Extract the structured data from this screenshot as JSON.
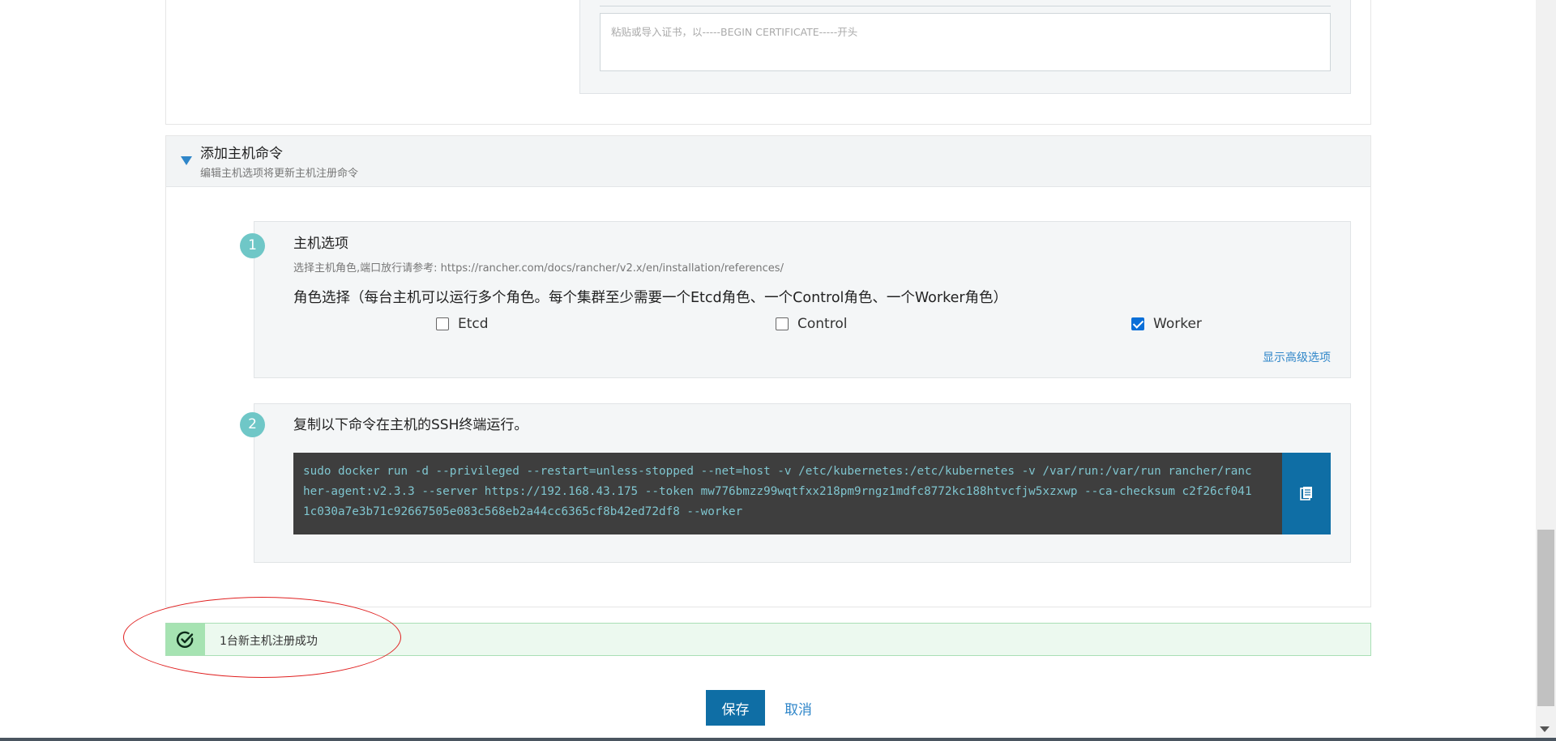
{
  "certificate": {
    "placeholder": "粘贴或导入证书，以-----BEGIN CERTIFICATE-----开头"
  },
  "accordion": {
    "title": "添加主机命令",
    "subtitle": "编辑主机选项将更新主机注册命令"
  },
  "step1": {
    "number": "1",
    "title": "主机选项",
    "desc": "选择主机角色,端口放行请参考: https://rancher.com/docs/rancher/v2.x/en/installation/references/",
    "role_title": "角色选择（每台主机可以运行多个角色。每个集群至少需要一个Etcd角色、一个Control角色、一个Worker角色）",
    "roles": [
      {
        "label": "Etcd",
        "checked": false
      },
      {
        "label": "Control",
        "checked": false
      },
      {
        "label": "Worker",
        "checked": true
      }
    ],
    "advanced_link": "显示高级选项"
  },
  "step2": {
    "number": "2",
    "title": "复制以下命令在主机的SSH终端运行。",
    "command": "sudo docker run -d --privileged --restart=unless-stopped --net=host -v /etc/kubernetes:/etc/kubernetes -v /var/run:/var/run rancher/rancher-agent:v2.3.3 --server https://192.168.43.175 --token mw776bmzz99wqtfxx218pm9rngz1mdfc8772kc188htvcfjw5xzxwp --ca-checksum c2f26cf0411c030a7e3b71c92667505e083c568eb2a44cc6365cf8b42ed72df8 --worker",
    "copy_icon": "clipboard-icon"
  },
  "success": {
    "icon": "check-circle-icon",
    "text": "1台新主机注册成功"
  },
  "actions": {
    "save": "保存",
    "cancel": "取消"
  },
  "colors": {
    "primary": "#0f6ea5",
    "link": "#2f86c9",
    "step_badge": "#6fc7c7",
    "success_bg": "#ecf9ef",
    "annotation": "#e02020"
  }
}
